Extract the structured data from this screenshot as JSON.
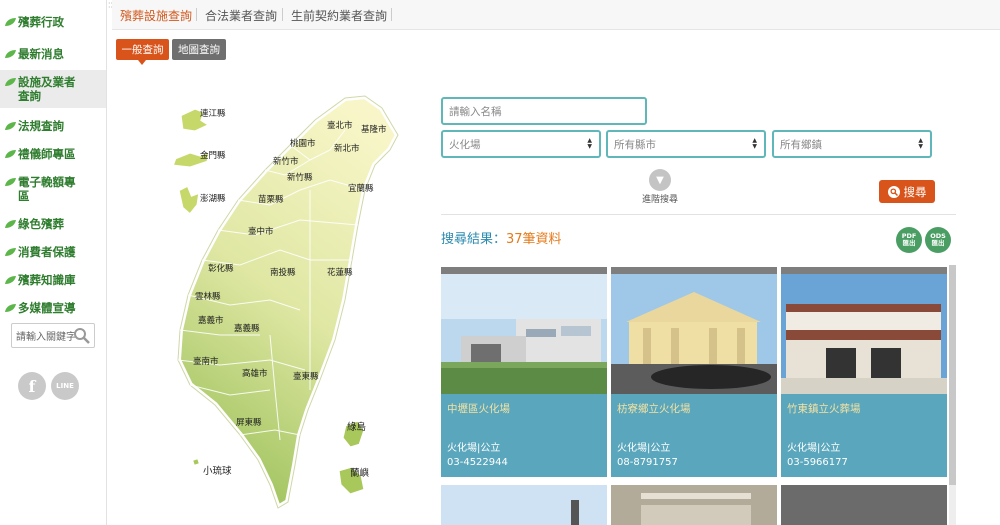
{
  "sidebar": {
    "items": [
      {
        "label": "殯葬行政"
      },
      {
        "label": "最新消息"
      },
      {
        "label": "設施及業者查詢"
      },
      {
        "label": "法規查詢"
      },
      {
        "label": "禮儀師專區"
      },
      {
        "label": "電子輓額專區"
      },
      {
        "label": "綠色殯葬"
      },
      {
        "label": "消費者保護"
      },
      {
        "label": "殯葬知識庫"
      },
      {
        "label": "多媒體宣導"
      }
    ],
    "search_placeholder": "請輸入關鍵字",
    "social": {
      "facebook": "f",
      "line": "LINE"
    }
  },
  "top_tabs": [
    "殯葬設施查詢",
    "合法業者查詢",
    "生前契約業者查詢"
  ],
  "sub_tabs": [
    "一般查詢",
    "地圖查詢"
  ],
  "map": {
    "regions": [
      "連江縣",
      "金門縣",
      "澎湖縣",
      "臺北市",
      "基隆市",
      "桃園市",
      "新北市",
      "新竹市",
      "新竹縣",
      "宜蘭縣",
      "苗栗縣",
      "臺中市",
      "彰化縣",
      "南投縣",
      "花蓮縣",
      "雲林縣",
      "嘉義市",
      "嘉義縣",
      "臺南市",
      "高雄市",
      "臺東縣",
      "屏東縣",
      "綠島",
      "蘭嶼",
      "小琉球"
    ]
  },
  "search": {
    "name_placeholder": "請輸入名稱",
    "type_selected": "火化場",
    "county_selected": "所有縣市",
    "town_selected": "所有鄉鎮",
    "advanced_label": "進階搜尋",
    "button_label": "搜尋"
  },
  "results": {
    "label": "搜尋結果：",
    "count": "37筆資料",
    "export_pdf": [
      "PDF",
      "匯出"
    ],
    "export_ods": [
      "ODS",
      "匯出"
    ],
    "items": [
      {
        "name": "中壢區火化場",
        "type": "火化場|公立",
        "phone": "03-4522944"
      },
      {
        "name": "枋寮鄉立火化場",
        "type": "火化場|公立",
        "phone": "08-8791757"
      },
      {
        "name": "竹東鎮立火葬場",
        "type": "火化場|公立",
        "phone": "03-5966177"
      }
    ]
  },
  "colors": {
    "accent": "#d8541b",
    "green": "#2f7d2f",
    "teal": "#5fb7b9",
    "card": "#5aa6bc",
    "link": "#2b8ab0"
  }
}
